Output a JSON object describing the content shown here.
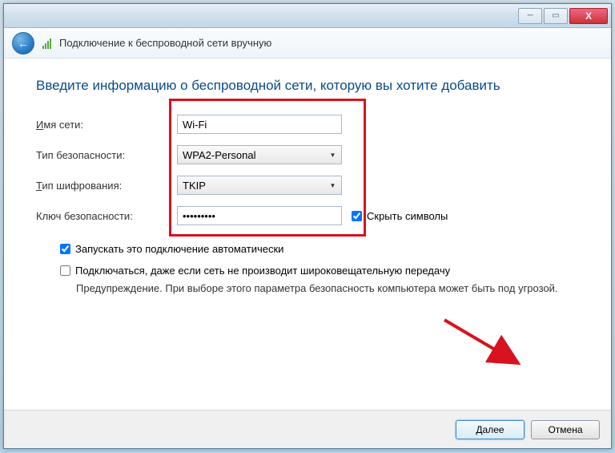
{
  "window": {
    "title": "Подключение к беспроводной сети вручную"
  },
  "heading": "Введите информацию о беспроводной сети, которую вы хотите добавить",
  "labels": {
    "network_name_pre": "И",
    "network_name_rest": "мя сети:",
    "security_type": "Тип безопасности:",
    "encryption_pre": "Т",
    "encryption_rest": "ип шифрования:",
    "security_key": "Ключ безопасности:"
  },
  "fields": {
    "network_name": "Wi-Fi",
    "security_type": "WPA2-Personal",
    "encryption_type": "TKIP",
    "security_key": "•••••••••"
  },
  "checkboxes": {
    "hide_chars_pre": "С",
    "hide_chars_rest": "крыть символы",
    "auto_connect_pre": "З",
    "auto_connect_rest": "апускать это подключение автоматически",
    "connect_hidden_pre": "П",
    "connect_hidden_rest": "одключаться, даже если сеть не производит широковещательную передачу"
  },
  "warning": "Предупреждение. При выборе этого параметра безопасность компьютера может быть под угрозой.",
  "buttons": {
    "next": "Далее",
    "cancel": "Отмена"
  }
}
